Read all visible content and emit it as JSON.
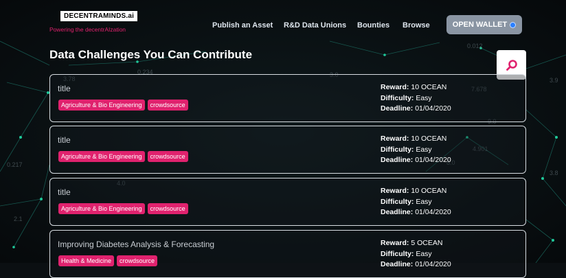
{
  "header": {
    "logo_text": "DECENTRAMINDS.ai",
    "tagline": "Powering the decentrAIzation",
    "nav": [
      {
        "label": "Publish an Asset"
      },
      {
        "label": "R&D Data Unions"
      },
      {
        "label": "Bounties"
      },
      {
        "label": "Browse"
      }
    ],
    "wallet_button": "OPEN WALLET"
  },
  "page": {
    "heading": "Data Challenges You Can Contribute"
  },
  "labels": {
    "reward": "Reward:",
    "difficulty": "Difficulty:",
    "deadline": "Deadline:"
  },
  "challenges": [
    {
      "title": "title",
      "tags": [
        "Agriculture & Bio Engineering",
        "crowdsource"
      ],
      "reward": "10 OCEAN",
      "difficulty": "Easy",
      "deadline": "01/04/2020"
    },
    {
      "title": "title",
      "tags": [
        "Agriculture & Bio Engineering",
        "crowdsource"
      ],
      "reward": "10 OCEAN",
      "difficulty": "Easy",
      "deadline": "01/04/2020"
    },
    {
      "title": "title",
      "tags": [
        "Agriculture & Bio Engineering",
        "crowdsource"
      ],
      "reward": "10 OCEAN",
      "difficulty": "Easy",
      "deadline": "01/04/2020"
    },
    {
      "title": "Improving Diabetes Analysis & Forecasting",
      "tags": [
        "Health & Medicine",
        "crowdsource"
      ],
      "reward": "5 OCEAN",
      "difficulty": "Easy",
      "deadline": "01/04/2020"
    }
  ],
  "background_numbers": [
    "0.012",
    "3.78",
    "0.234",
    "7.678",
    "4.901",
    "3.9",
    "0.217",
    "2.1",
    "9.0",
    "3.0",
    "3.8",
    "4.0",
    "8.0"
  ],
  "colors": {
    "accent": "#e0226e",
    "network": "#1fc99a",
    "background": "#0b0f12"
  }
}
